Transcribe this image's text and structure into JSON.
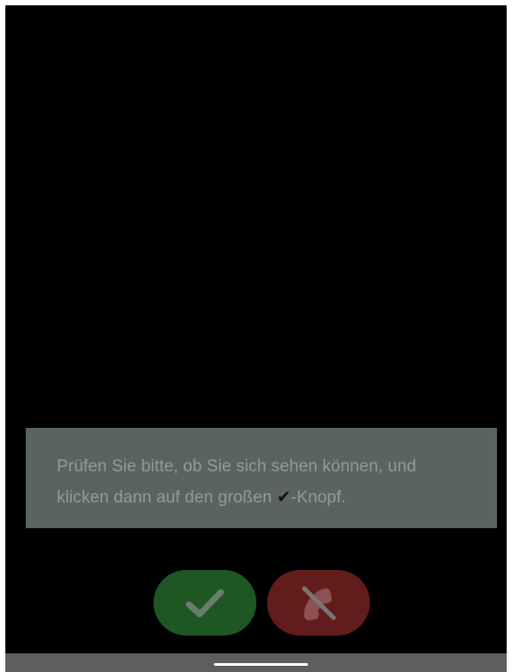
{
  "instruction": {
    "text_before": "Prüfen Sie bitte, ob Sie sich sehen können, und klicken dann auf den großen ",
    "check_symbol": "✔",
    "text_after": "-Knopf."
  },
  "buttons": {
    "confirm": {
      "icon": "checkmark-icon",
      "color": "#1e5624"
    },
    "hangup": {
      "icon": "hangup-phone-icon",
      "color": "#621c1c"
    }
  },
  "colors": {
    "background": "#000000",
    "overlay_box": "#5a6262",
    "overlay_text": "#929a9a",
    "home_bar": "#5e5e5e"
  }
}
